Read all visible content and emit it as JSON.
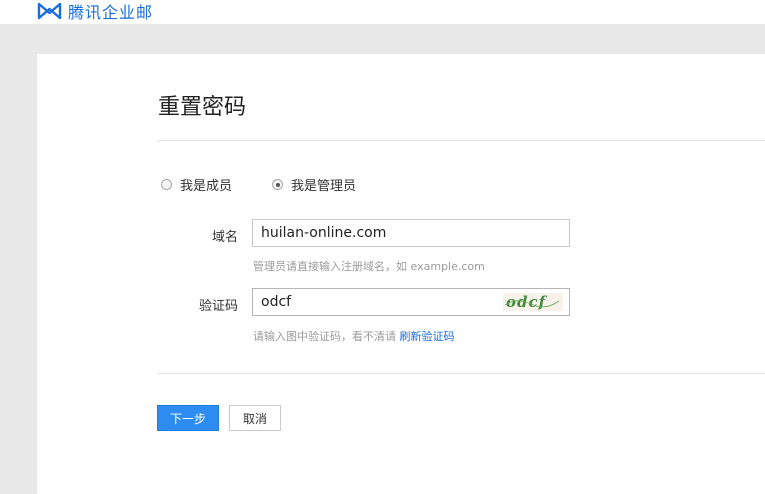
{
  "app": {
    "name": "腾讯企业邮",
    "brand_color": "#1a6ddc",
    "logo_icon": "tencent-exmail-logo-icon"
  },
  "form": {
    "title": "重置密码",
    "roles": [
      {
        "label": "我是成员",
        "checked": false
      },
      {
        "label": "我是管理员",
        "checked": true
      }
    ],
    "domain": {
      "label": "域名",
      "value": "huilan-online.com",
      "hint": "管理员请直接输入注册域名，如 example.com"
    },
    "captcha": {
      "label": "验证码",
      "value": "odcf",
      "hint": "请输入图中验证码，看不清请",
      "refresh_link": "刷新验证码",
      "image_text": "odcf"
    },
    "buttons": {
      "next": "下一步",
      "cancel": "取消"
    },
    "primary_color": "#2d8cf0"
  }
}
